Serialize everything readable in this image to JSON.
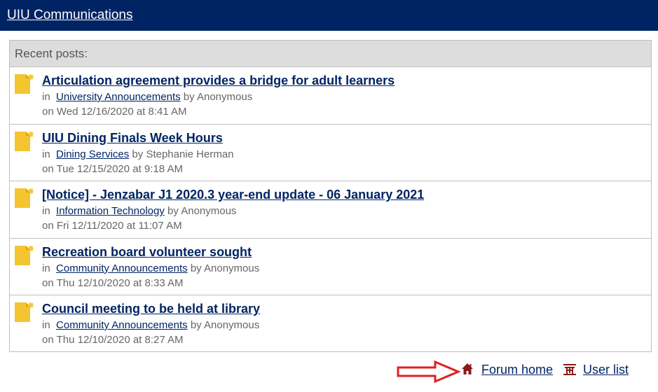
{
  "header": {
    "title": "UIU Communications"
  },
  "panel": {
    "heading": "Recent posts:",
    "in_label": "in",
    "by_label": "by",
    "posts": [
      {
        "title": "Articulation agreement provides a bridge for adult learners",
        "category": "University Announcements",
        "author": "Anonymous",
        "date": "on Wed 12/16/2020 at 8:41 AM"
      },
      {
        "title": "UIU Dining Finals Week Hours",
        "category": "Dining Services",
        "author": "Stephanie Herman",
        "date": "on Tue 12/15/2020 at 9:18 AM"
      },
      {
        "title": "[Notice] - Jenzabar J1 2020.3 year-end update - 06 January 2021",
        "category": "Information Technology",
        "author": "Anonymous",
        "date": "on Fri 12/11/2020 at 11:07 AM"
      },
      {
        "title": "Recreation board volunteer sought",
        "category": "Community Announcements",
        "author": "Anonymous",
        "date": "on Thu 12/10/2020 at 8:33 AM"
      },
      {
        "title": "Council meeting to be held at library",
        "category": "Community Announcements",
        "author": "Anonymous",
        "date": "on Thu 12/10/2020 at 8:27 AM"
      }
    ]
  },
  "footer": {
    "forum_home": "Forum home",
    "user_list": "User list"
  },
  "colors": {
    "header_bg": "#002463",
    "link": "#002463",
    "icon_yellow": "#f5c431",
    "icon_red": "#8b1a1a",
    "arrow_red": "#e02020"
  },
  "icons": {
    "post": "new-document-icon",
    "forum_home": "home-icon",
    "user_list": "users-icon",
    "pointer": "arrow-right-icon"
  }
}
